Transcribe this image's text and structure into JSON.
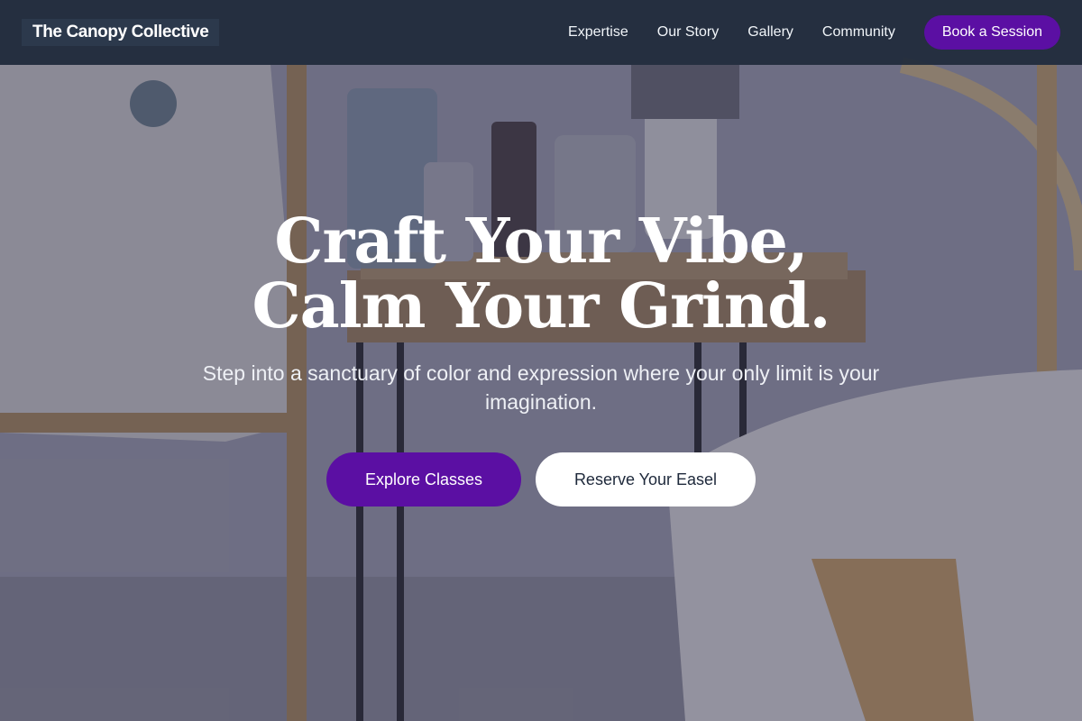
{
  "nav": {
    "brand": "The Canopy Collective",
    "links": [
      "Expertise",
      "Our Story",
      "Gallery",
      "Community"
    ],
    "cta_label": "Book a Session"
  },
  "hero": {
    "headline_line1": "Craft Your Vibe,",
    "headline_line2": "Calm Your Grind.",
    "subheadline": "Step into a sanctuary of color and expression where your only limit is your imagination.",
    "primary_cta": "Explore Classes",
    "secondary_cta": "Reserve Your Easel",
    "background_image": "art-studio-photo"
  },
  "colors": {
    "accent": "#5b0fa3",
    "nav_background": "#1e293b",
    "text_light": "#ffffff"
  }
}
